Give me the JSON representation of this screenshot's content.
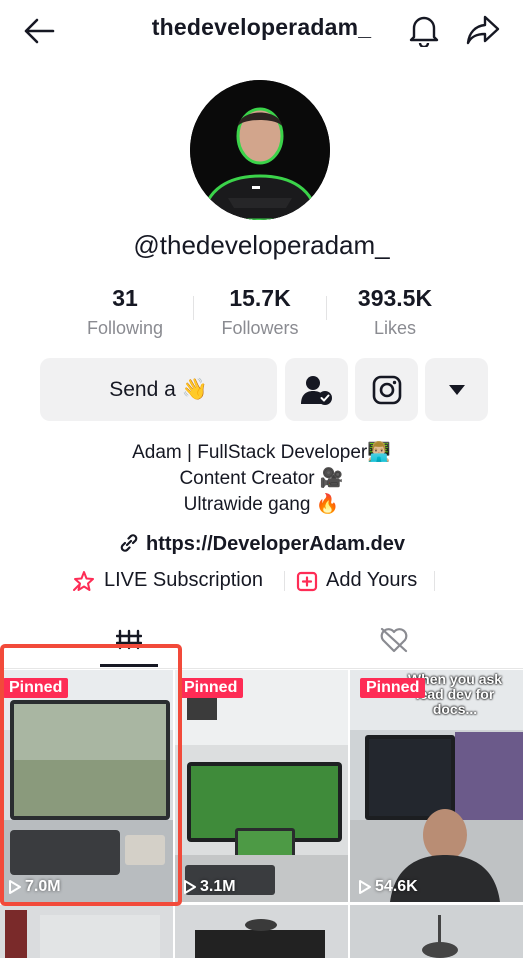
{
  "header": {
    "title": "thedeveloperadam_",
    "back_icon": "arrow-left-icon",
    "notification_icon": "bell-icon",
    "share_icon": "share-arrow-icon"
  },
  "profile": {
    "handle": "@thedeveloperadam_",
    "stats": [
      {
        "value": "31",
        "label": "Following"
      },
      {
        "value": "15.7K",
        "label": "Followers"
      },
      {
        "value": "393.5K",
        "label": "Likes"
      }
    ]
  },
  "actions": {
    "send_label": "Send a 👋",
    "friend_icon": "user-check-icon",
    "instagram_icon": "instagram-icon",
    "more_icon": "caret-down-icon"
  },
  "bio": {
    "lines": [
      "Adam | FullStack Developer👨🏼‍💻",
      "Content Creator 🎥",
      "Ultrawide gang 🔥"
    ],
    "link": "https://DeveloperAdam.dev",
    "link_icon": "link-icon"
  },
  "features": {
    "live_subscription": "LIVE Subscription",
    "add_yours": "Add Yours"
  },
  "tabs": {
    "videos_icon": "grid-icon",
    "liked_icon": "hidden-heart-icon"
  },
  "videos": [
    {
      "pinned": "Pinned",
      "views": "7.0M",
      "overlay": ""
    },
    {
      "pinned": "Pinned",
      "views": "3.1M",
      "overlay": ""
    },
    {
      "pinned": "Pinned",
      "views": "54.6K",
      "overlay": "When you ask lead dev for docs..."
    }
  ],
  "colors": {
    "accent": "#fe2c55",
    "highlight": "#f24a3a",
    "text": "#161823",
    "muted": "#8a8b91"
  }
}
